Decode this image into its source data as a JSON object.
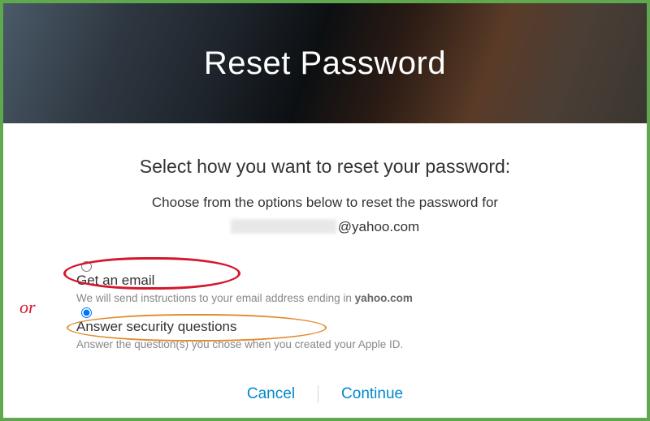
{
  "header": {
    "title": "Reset Password"
  },
  "prompt": "Select how you want to reset your password:",
  "subprompt": "Choose from the options below to reset the password for",
  "email_domain": "@yahoo.com",
  "options": [
    {
      "label": "Get an email",
      "description_prefix": "We will send instructions to your email address ending in ",
      "description_bold": "yahoo.com",
      "selected": false
    },
    {
      "label": "Answer security questions",
      "description": "Answer the question(s) you chose when you created your Apple ID.",
      "selected": true
    }
  ],
  "annotation": {
    "or": "or"
  },
  "actions": {
    "cancel": "Cancel",
    "continue": "Continue"
  }
}
